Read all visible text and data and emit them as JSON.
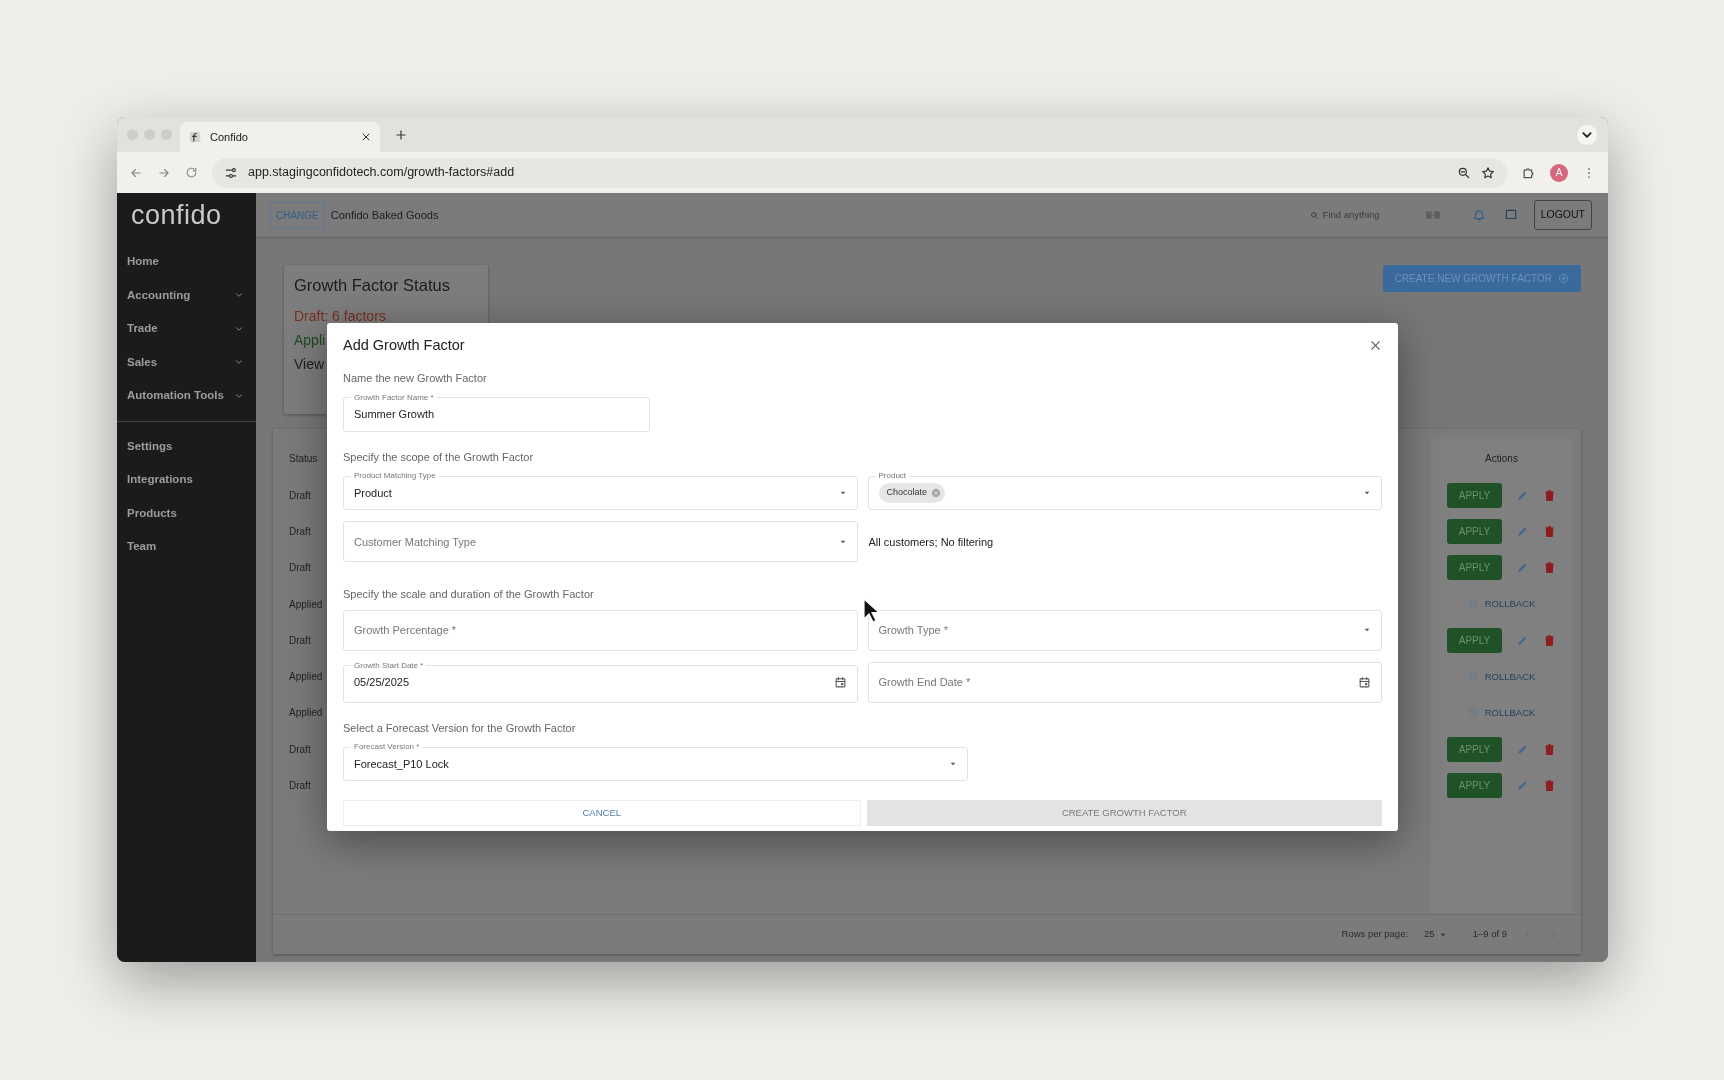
{
  "browser": {
    "tabs": [
      {
        "title": "Confido",
        "selected": true
      }
    ],
    "url": "app.stagingconfidotech.com/growth-factors#add",
    "profile_initial": "A"
  },
  "app": {
    "logo": "confido",
    "sidebar": {
      "sections": [
        [
          {
            "label": "Home",
            "submenu": false
          },
          {
            "label": "Accounting",
            "submenu": true
          },
          {
            "label": "Trade",
            "submenu": true
          },
          {
            "label": "Sales",
            "submenu": true
          },
          {
            "label": "Automation Tools",
            "submenu": true
          }
        ],
        [
          {
            "label": "Settings",
            "submenu": false
          },
          {
            "label": "Integrations",
            "submenu": false
          },
          {
            "label": "Products",
            "submenu": false
          },
          {
            "label": "Team",
            "submenu": false
          }
        ]
      ]
    },
    "header": {
      "change_button": "CHANGE",
      "company": "Confido Baked Goods",
      "search_placeholder": "Find anything",
      "logout": "LOGOUT"
    },
    "status_card": {
      "title": "Growth Factor Status",
      "lines": [
        {
          "text": "Draft: 6 factors",
          "kind": "draft"
        },
        {
          "text": "Appli",
          "kind": "applied"
        },
        {
          "text": "View",
          "kind": "link"
        }
      ]
    },
    "create_button": "CREATE NEW GROWTH FACTOR",
    "table": {
      "status_header": "Status",
      "actions_header": "Actions",
      "rows": [
        {
          "status": "Draft",
          "kind": "draft",
          "action": "APPLY"
        },
        {
          "status": "Draft",
          "kind": "draft",
          "action": "APPLY"
        },
        {
          "status": "Draft",
          "kind": "draft",
          "action": "APPLY"
        },
        {
          "status": "Applied",
          "kind": "applied",
          "action": "ROLLBACK"
        },
        {
          "status": "Draft",
          "kind": "draft",
          "action": "APPLY"
        },
        {
          "status": "Applied",
          "kind": "applied",
          "action": "ROLLBACK"
        },
        {
          "status": "Applied",
          "kind": "applied",
          "action": "ROLLBACK"
        },
        {
          "status": "Draft",
          "kind": "draft",
          "action": "APPLY"
        },
        {
          "status": "Draft",
          "kind": "draft",
          "action": "APPLY"
        }
      ]
    },
    "pagination": {
      "rows_label": "Rows per page:",
      "rows_value": "25",
      "range": "1–9 of 9"
    }
  },
  "dialog": {
    "title": "Add Growth Factor",
    "sections": [
      {
        "heading": "Name the new Growth Factor",
        "rows": [
          [
            {
              "kind": "text",
              "label": "Growth Factor Name *",
              "value": "Summer Growth"
            }
          ]
        ]
      },
      {
        "heading": "Specify the scope of the Growth Factor",
        "rows": [
          [
            {
              "kind": "select",
              "label": "Product Matching Type",
              "value": "Product"
            },
            {
              "kind": "select",
              "label": "Product",
              "chips": [
                {
                  "label": "Chocolate"
                }
              ]
            }
          ],
          [
            {
              "kind": "select",
              "placeholder": "Customer Matching Type"
            },
            {
              "kind": "note",
              "text": "All customers; No filtering"
            }
          ]
        ]
      },
      {
        "heading": "Specify the scale and duration of the Growth Factor",
        "rows": [
          [
            {
              "kind": "text",
              "placeholder": "Growth Percentage *"
            },
            {
              "kind": "select",
              "placeholder": "Growth Type *"
            }
          ],
          [
            {
              "kind": "date",
              "label": "Growth Start Date *",
              "value": "05/25/2025"
            },
            {
              "kind": "date",
              "placeholder": "Growth End Date *"
            }
          ]
        ]
      },
      {
        "heading": "Select a Forecast Version for the Growth Factor",
        "rows": [
          [
            {
              "kind": "select",
              "label": "Forecast Version *",
              "value": "Forecast_P10 Lock",
              "wide": true
            }
          ]
        ]
      }
    ],
    "cancel": "CANCEL",
    "submit": {
      "label": "CREATE GROWTH FACTOR",
      "disabled": true
    }
  }
}
